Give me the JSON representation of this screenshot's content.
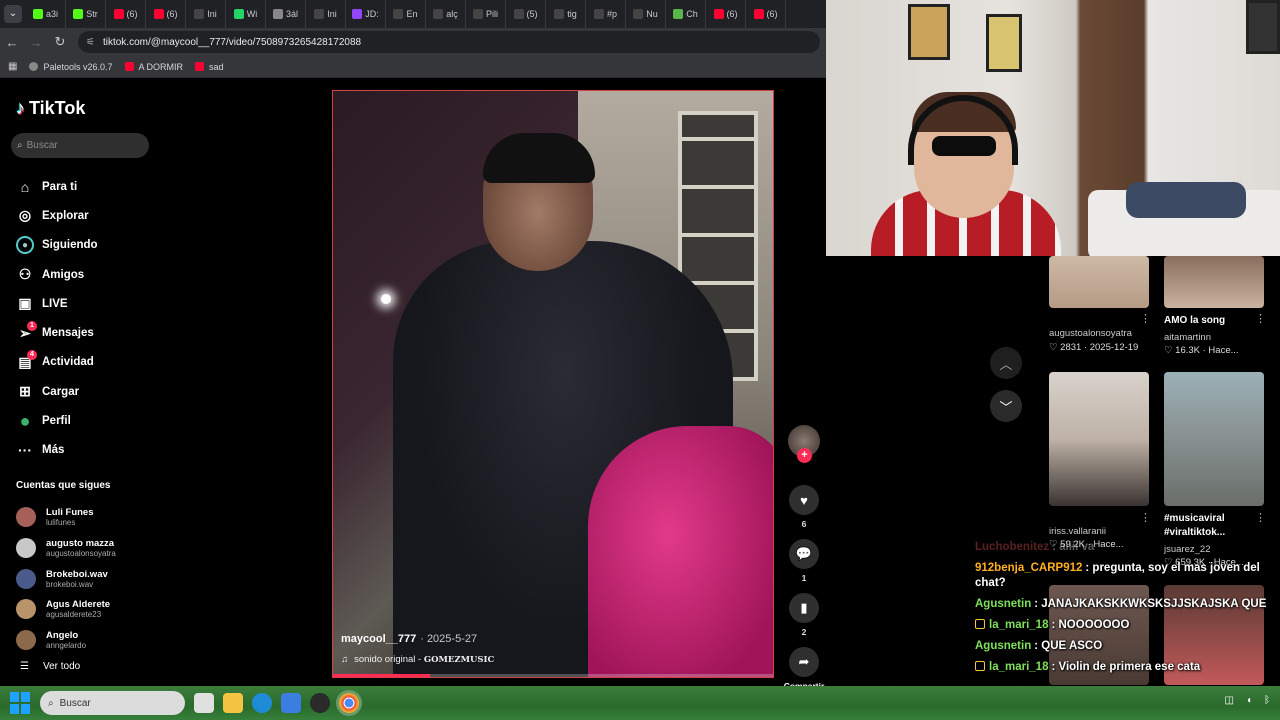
{
  "browser": {
    "tabs": [
      {
        "label": "a3i",
        "icon": "k-icon",
        "color": "#53fc18"
      },
      {
        "label": "Str",
        "icon": "k-icon",
        "color": "#53fc18"
      },
      {
        "label": "(6)",
        "icon": "youtube-icon",
        "color": "#ff0033"
      },
      {
        "label": "(6)",
        "icon": "youtube-icon",
        "color": "#ff0033"
      },
      {
        "label": "Ini",
        "icon": "x-icon",
        "color": "#ffffff"
      },
      {
        "label": "Wi",
        "icon": "whatsapp-icon",
        "color": "#25d366"
      },
      {
        "label": "3ál",
        "icon": "globe-icon",
        "color": "#888888"
      },
      {
        "label": "Ini",
        "icon": "x-icon",
        "color": "#ffffff"
      },
      {
        "label": "JD:",
        "icon": "twitch-icon",
        "color": "#9146ff"
      },
      {
        "label": "En",
        "icon": "tiktok-icon",
        "color": "#ffffff"
      },
      {
        "label": "alç",
        "icon": "google-icon",
        "color": "#ffffff"
      },
      {
        "label": "Pili",
        "icon": "tiktok-icon",
        "color": "#ffffff"
      },
      {
        "label": "(5)",
        "icon": "tiktok-icon",
        "color": "#ffffff"
      },
      {
        "label": "tig",
        "icon": "google-icon",
        "color": "#ffffff"
      },
      {
        "label": "#p",
        "icon": "tiktok-icon",
        "color": "#ffffff"
      },
      {
        "label": "Nu",
        "icon": "globe-icon",
        "color": "#ffffff"
      },
      {
        "label": "Ch",
        "icon": "globe-icon",
        "color": "#5ab74a"
      },
      {
        "label": "(6)",
        "icon": "youtube-icon",
        "color": "#ff0033"
      },
      {
        "label": "(6)",
        "icon": "youtube-icon",
        "color": "#ff0033"
      }
    ],
    "url": "tiktok.com/@maycool__777/video/7508973265428172088",
    "bookmarks": [
      {
        "label": "Paletools v26.0.7",
        "color": "#888888"
      },
      {
        "label": "A DORMIR",
        "color": "#ff0033"
      },
      {
        "label": "sad",
        "color": "#ff0033"
      }
    ]
  },
  "tiktok": {
    "logo": "TikTok",
    "search_placeholder": "Buscar",
    "nav": [
      {
        "label": "Para ti",
        "icon": "home-icon"
      },
      {
        "label": "Explorar",
        "icon": "compass-icon"
      },
      {
        "label": "Siguiendo",
        "icon": "following-avatar-icon"
      },
      {
        "label": "Amigos",
        "icon": "friends-icon"
      },
      {
        "label": "LIVE",
        "icon": "live-icon"
      },
      {
        "label": "Mensajes",
        "icon": "messages-icon",
        "badge": "1"
      },
      {
        "label": "Actividad",
        "icon": "activity-icon",
        "badge": "4"
      },
      {
        "label": "Cargar",
        "icon": "upload-icon"
      },
      {
        "label": "Perfil",
        "icon": "profile-icon"
      },
      {
        "label": "Más",
        "icon": "more-icon"
      }
    ],
    "following_title": "Cuentas que sigues",
    "following": [
      {
        "name": "Luli Funes",
        "handle": "lulifunes"
      },
      {
        "name": "augusto mazza",
        "handle": "augustoalonsoyatra"
      },
      {
        "name": "Brokeboi.wav",
        "handle": "brokeboi.wav"
      },
      {
        "name": "Agus Alderete",
        "handle": "agusalderete23"
      },
      {
        "name": "Angelo",
        "handle": "anngelardo"
      }
    ],
    "see_all": "Ver todo",
    "video": {
      "author": "maycool__777",
      "date": "· 2025-5-27",
      "sound": "sonido original - ",
      "sound_artist": "GOMEZMUSIC",
      "progress": 0.22
    },
    "actions": {
      "likes": "6",
      "comments": "1",
      "saves": "2",
      "share": "Compartir"
    },
    "feed": [
      {
        "title": "",
        "user": "augustoalonsoyatra",
        "stats": "♡ 2831 · 2025-12-19"
      },
      {
        "title": "AMO la song",
        "user": "aitamartinn",
        "stats": "♡ 16.3K · Hace..."
      },
      {
        "title": "",
        "user": "iriss.vallaranii",
        "stats": "♡ 59.2K · Hace..."
      },
      {
        "title": "#musicaviral #viraltiktok...",
        "user": "jsuarez_22",
        "stats": "♡ 659.3K · Hace..."
      }
    ]
  },
  "chat": [
    {
      "user": "Luchobenitez",
      "msg": ": aiiii va",
      "color": "#ff5c5c",
      "faded": true
    },
    {
      "user": "912benja_CARP912",
      "msg": ": pregunta, soy el mas joven del chat?",
      "color": "#ffb020",
      "faded": false
    },
    {
      "user": "Agusnetin",
      "msg": ": JANAJKAKSKKWKSKSJJSKAJSKA QUE",
      "color": "#7ee05a",
      "faded": false
    },
    {
      "user": "la_mari_18",
      "msg": ": NOOOOOOO",
      "color": "#7ee05a",
      "faded": false,
      "badge": true
    },
    {
      "user": "Agusnetin",
      "msg": ": QUE ASCO",
      "color": "#7ee05a",
      "faded": false
    },
    {
      "user": "la_mari_18",
      "msg": ": Violin de primera ese cata",
      "color": "#7ee05a",
      "faded": false,
      "badge": true
    }
  ],
  "taskbar": {
    "search_placeholder": "Buscar"
  }
}
